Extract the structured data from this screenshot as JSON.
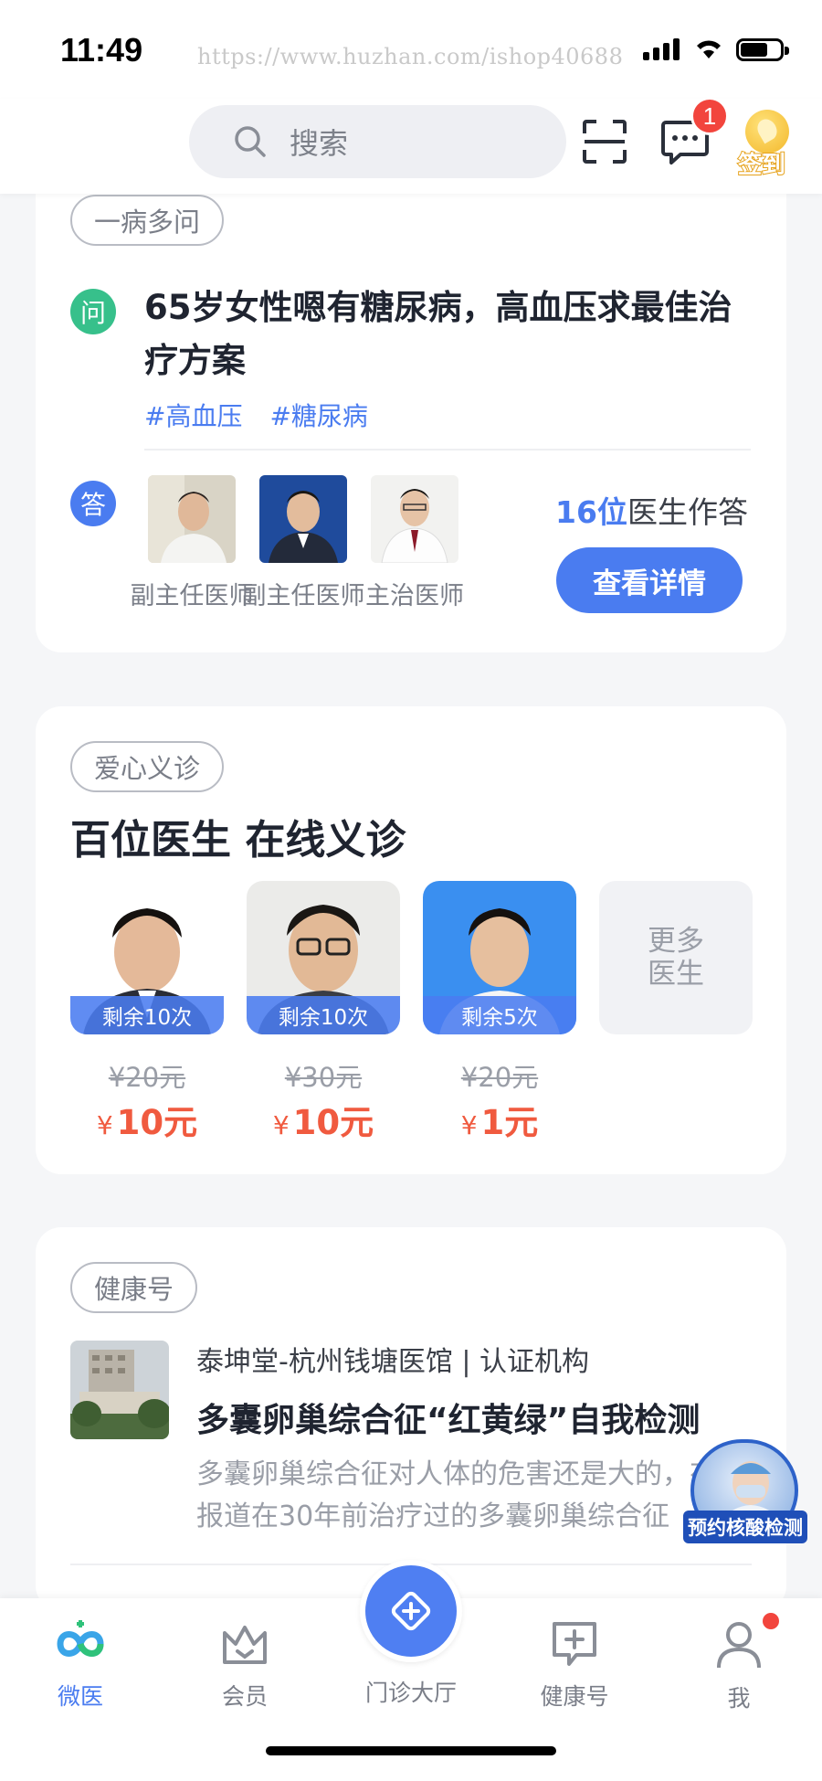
{
  "status_bar": {
    "time": "11:49",
    "watermark": "https://www.huzhan.com/ishop40688"
  },
  "header": {
    "search_placeholder": "搜索",
    "message_badge": "1",
    "signin_label": "签到"
  },
  "consult_card": {
    "tag": "一病多问",
    "q_icon": "问",
    "a_icon": "答",
    "question": "65岁女性嗯有糖尿病，高血压求最佳治疗方案",
    "topics": [
      "#高血压",
      "#糖尿病"
    ],
    "doctors": [
      {
        "title": "副主任医师"
      },
      {
        "title": "副主任医师"
      },
      {
        "title": "主治医师"
      }
    ],
    "answer_count": "16位",
    "answer_suffix": "医生作答",
    "detail_button": "查看详情"
  },
  "charity_card": {
    "tag": "爱心义诊",
    "title": "百位医生 在线义诊",
    "doctors": [
      {
        "remain": "剩余10次",
        "old_price": "¥20元",
        "currency": "¥",
        "new_price": "10元"
      },
      {
        "remain": "剩余10次",
        "old_price": "¥30元",
        "currency": "¥",
        "new_price": "10元"
      },
      {
        "remain": "剩余5次",
        "old_price": "¥20元",
        "currency": "¥",
        "new_price": "1元"
      }
    ],
    "more": "更多医生"
  },
  "health_card": {
    "tag": "健康号",
    "source": "泰坤堂-杭州钱塘医馆 | 认证机构",
    "title": "多囊卵巢综合征“红黄绿”自我检测",
    "excerpt": "多囊卵巢综合征对人体的危害还是大的，有报道在30年前治疗过的多囊卵巢综合征"
  },
  "floating_ad": {
    "label": "预约核酸检测"
  },
  "tabbar": {
    "items": [
      {
        "label": "微医",
        "icon": "weiyi-logo-icon"
      },
      {
        "label": "会员",
        "icon": "crown-icon"
      },
      {
        "label": "门诊大厅",
        "icon": "clinic-icon"
      },
      {
        "label": "健康号",
        "icon": "health-post-icon"
      },
      {
        "label": "我",
        "icon": "person-icon"
      }
    ]
  },
  "colors": {
    "accent": "#4a7cf0",
    "price": "#f05a3f",
    "question": "#37c08b",
    "badge": "#f2453d"
  }
}
